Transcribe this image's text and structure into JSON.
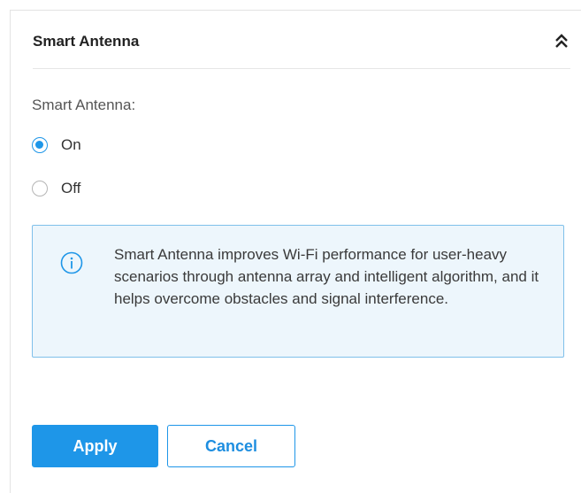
{
  "section": {
    "title": "Smart Antenna",
    "collapse_icon": "double-chevron-up-icon"
  },
  "form": {
    "field_label": "Smart Antenna:",
    "options": [
      {
        "label": "On",
        "checked": true
      },
      {
        "label": "Off",
        "checked": false
      }
    ]
  },
  "info": {
    "icon": "info-circle-icon",
    "text": "Smart Antenna improves Wi-Fi performance for user-heavy scenarios through antenna array and intelligent algorithm, and it helps overcome obstacles and signal interference."
  },
  "buttons": {
    "apply_label": "Apply",
    "cancel_label": "Cancel"
  },
  "colors": {
    "accent": "#1e96e8",
    "info_background": "#edf6fc",
    "info_border": "#7fc0ea"
  }
}
